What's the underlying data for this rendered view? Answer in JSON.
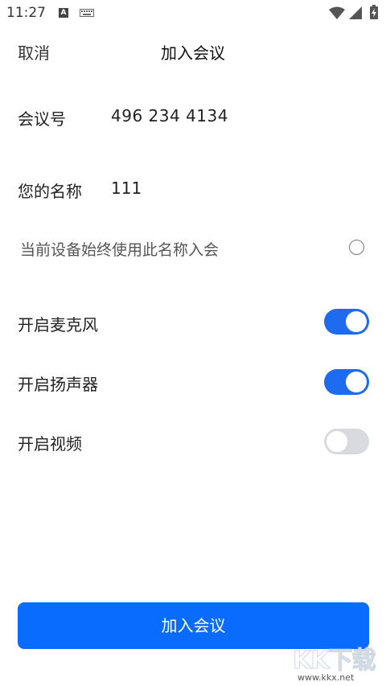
{
  "status_bar": {
    "time": "11:27",
    "icons": [
      "a-notification-icon",
      "keyboard-icon",
      "wifi-icon",
      "signal-icon",
      "battery-icon"
    ]
  },
  "header": {
    "cancel_label": "取消",
    "title": "加入会议"
  },
  "meeting": {
    "label": "会议号",
    "value": "496 234 4134"
  },
  "name": {
    "label": "您的名称",
    "value": "111"
  },
  "remember": {
    "label": "当前设备始终使用此名称入会",
    "checked": false
  },
  "toggles": [
    {
      "label": "开启麦克风",
      "on": true
    },
    {
      "label": "开启扬声器",
      "on": true
    },
    {
      "label": "开启视频",
      "on": false
    }
  ],
  "join_button_label": "加入会议",
  "colors": {
    "accent": "#0a6cff",
    "toggle_on": "#1f6bf0",
    "toggle_off": "#d8dadf"
  },
  "watermark": {
    "logo": "KK下载",
    "url": "www.kkx.net"
  }
}
